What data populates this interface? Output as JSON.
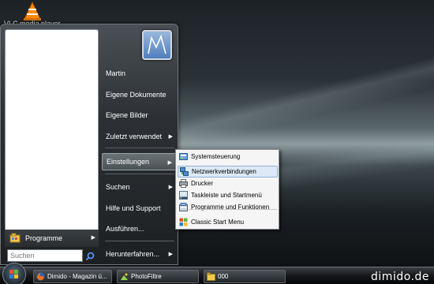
{
  "desktop": {
    "icon_label": "VLC media player"
  },
  "start_menu": {
    "programs_label": "Programme",
    "search_placeholder": "Suchen",
    "right_items": [
      {
        "label": "Martin"
      },
      {
        "label": "Eigene Dokumente"
      },
      {
        "label": "Eigene Bilder"
      },
      {
        "label": "Zuletzt verwendet"
      },
      {
        "label": "Einstellungen"
      },
      {
        "label": "Suchen"
      },
      {
        "label": "Hilfe und Support"
      },
      {
        "label": "Ausführen..."
      },
      {
        "label": "Herunterfahren..."
      }
    ]
  },
  "submenu": {
    "items": [
      {
        "label": "Systemsteuerung",
        "icon": "control-panel-icon"
      },
      {
        "label": "Netzwerkverbindungen",
        "icon": "network-icon"
      },
      {
        "label": "Drucker",
        "icon": "printer-icon"
      },
      {
        "label": "Taskleiste und Startmenü",
        "icon": "taskbar-icon"
      },
      {
        "label": "Programme und Funktionen",
        "icon": "programs-icon"
      },
      {
        "label": "Classic Start Menu",
        "icon": "classic-start-icon"
      }
    ]
  },
  "taskbar": {
    "buttons": [
      {
        "label": "Dimido - Magazin ü...",
        "icon": "firefox-icon"
      },
      {
        "label": "PhotoFiltre",
        "icon": "photofiltre-icon"
      },
      {
        "label": "000",
        "icon": "folder-icon"
      }
    ]
  },
  "watermark": "dimido.de",
  "colors": {
    "menu_dark": "#2c3034",
    "submenu_bg": "#f5f5f5",
    "highlight": "#dde9f6",
    "taskbar": "#15171a"
  }
}
